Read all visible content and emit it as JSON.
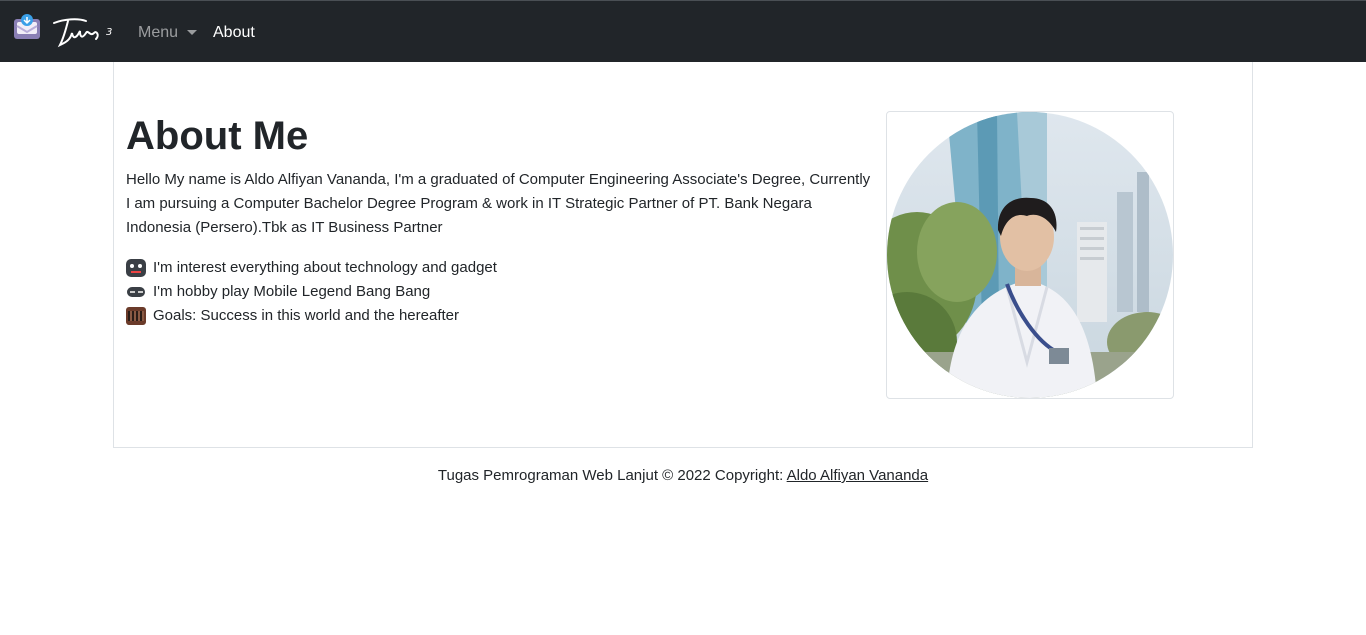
{
  "navbar": {
    "brand_icon": "mail-inbox-icon",
    "brand_logo_text": "Tugas 3",
    "menu_label": "Menu",
    "about_label": "About"
  },
  "main": {
    "title": "About Me",
    "intro": "Hello My name is Aldo Alfiyan Vananda, I'm a graduated of Computer Engineering Associate's Degree, Currently I am pursuing a Computer Bachelor Degree Program & work in IT Strategic Partner of PT. Bank Negara Indonesia (Persero).Tbk as IT Business Partner",
    "facts": [
      {
        "icon": "robot-icon",
        "text": "I'm interest everything about technology and gadget"
      },
      {
        "icon": "gamepad-icon",
        "text": "I'm hobby play Mobile Legend Bang Bang"
      },
      {
        "icon": "keyboard-icon",
        "text": "Goals: Success in this world and the hereafter"
      }
    ],
    "photo_alt": "profile-photo"
  },
  "footer": {
    "text": "Tugas Pemrograman Web Lanjut © 2022 Copyright: ",
    "link_text": "Aldo Alfiyan Vananda"
  },
  "colors": {
    "navbar_bg": "#212529",
    "text": "#212529",
    "border": "#dee2e6"
  }
}
